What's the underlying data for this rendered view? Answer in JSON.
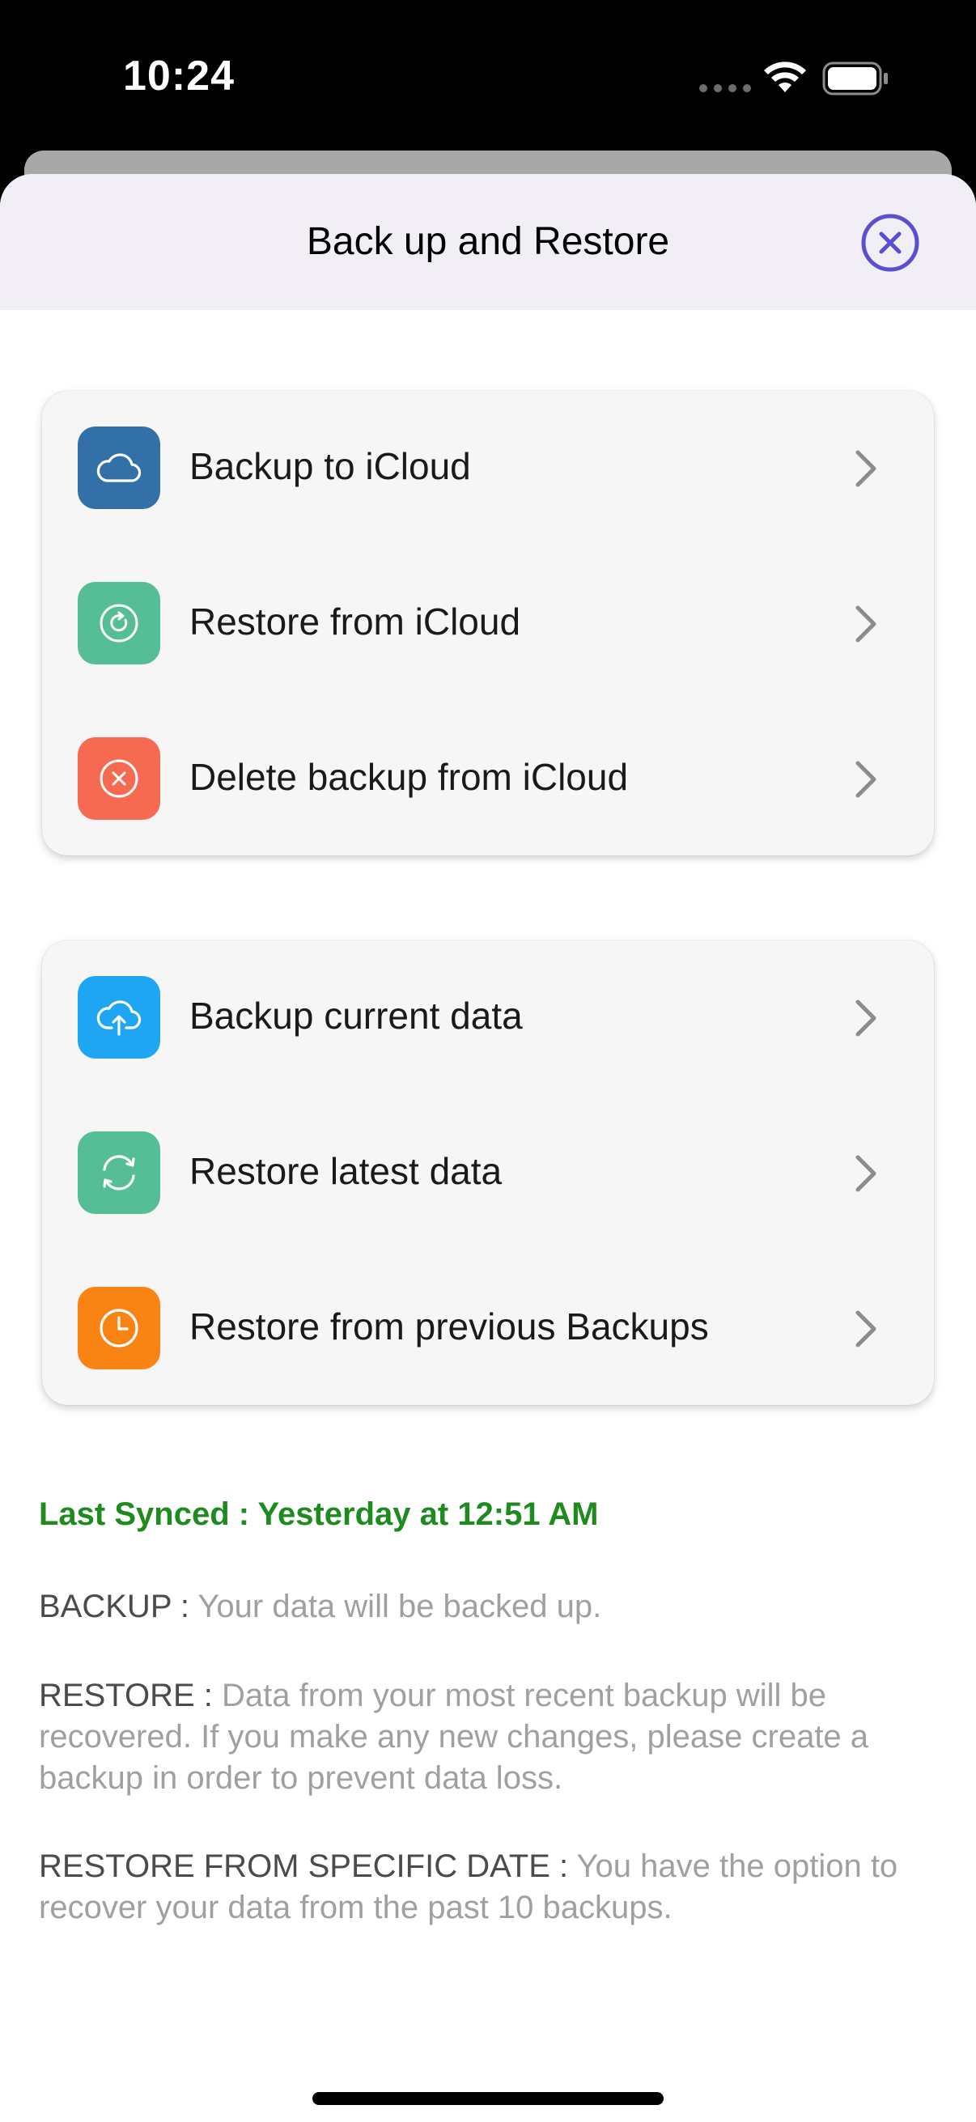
{
  "status_bar": {
    "time": "10:24",
    "icons": [
      "signal-dots-icon",
      "wifi-icon",
      "battery-icon"
    ]
  },
  "sheet": {
    "title": "Back up and Restore",
    "close_icon": "close-circle-icon",
    "accent_color": "#5a4fcf"
  },
  "icloud_group": {
    "items": [
      {
        "label": "Backup to iCloud",
        "icon": "cloud-icon",
        "color": "#3470a8"
      },
      {
        "label": "Restore from iCloud",
        "icon": "restore-circle-icon",
        "color": "#56be96"
      },
      {
        "label": "Delete backup from iCloud",
        "icon": "delete-circle-icon",
        "color": "#f76a52"
      }
    ]
  },
  "local_group": {
    "items": [
      {
        "label": "Backup current data",
        "icon": "cloud-upload-icon",
        "color": "#1ea6f2"
      },
      {
        "label": "Restore latest data",
        "icon": "sync-icon",
        "color": "#56be96"
      },
      {
        "label": "Restore from previous Backups",
        "icon": "clock-icon",
        "color": "#f98413"
      }
    ]
  },
  "info": {
    "last_synced": "Last Synced : Yesterday at 12:51 AM",
    "last_synced_color": "#1f8a1f",
    "backup_key": " BACKUP : ",
    "backup_text": " Your data will be backed up.",
    "restore_key": " RESTORE : ",
    "restore_text": "Data from your most recent backup will be recovered. If you make any new changes, please create a backup in order to prevent data loss.",
    "specific_key": "RESTORE FROM SPECIFIC DATE : ",
    "specific_text": "You have the option to recover your data from the past 10 backups."
  }
}
